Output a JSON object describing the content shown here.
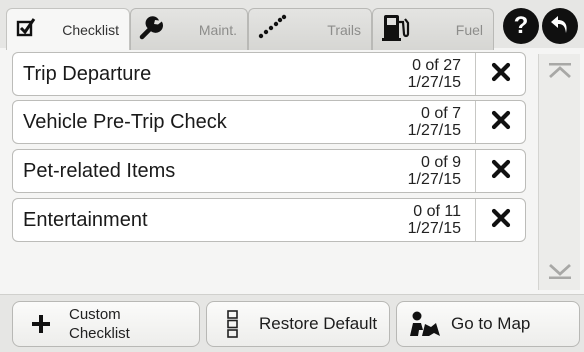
{
  "tabs": [
    {
      "label": "Checklist",
      "icon": "checkbox-icon",
      "active": true
    },
    {
      "label": "Maint.",
      "icon": "wrench-icon",
      "active": false
    },
    {
      "label": "Trails",
      "icon": "trail-dots-icon",
      "active": false
    },
    {
      "label": "Fuel",
      "icon": "fuel-pump-icon",
      "active": false
    }
  ],
  "header_buttons": {
    "help_label": "?",
    "back_icon": "back-arrow-icon"
  },
  "checklists": [
    {
      "title": "Trip Departure",
      "progress": "0 of 27",
      "date": "1/27/15"
    },
    {
      "title": "Vehicle Pre-Trip Check",
      "progress": "0 of 7",
      "date": "1/27/15"
    },
    {
      "title": "Pet-related Items",
      "progress": "0 of 9",
      "date": "1/27/15"
    },
    {
      "title": "Entertainment",
      "progress": "0 of 11",
      "date": "1/27/15"
    }
  ],
  "bottom": {
    "custom_line1": "Custom",
    "custom_line2": "Checklist",
    "restore_label": "Restore Default",
    "map_label": "Go to Map"
  },
  "colors": {
    "accent": "#101010",
    "background": "#f5f5f4",
    "disabled_scroll": "#a8a8a6"
  }
}
